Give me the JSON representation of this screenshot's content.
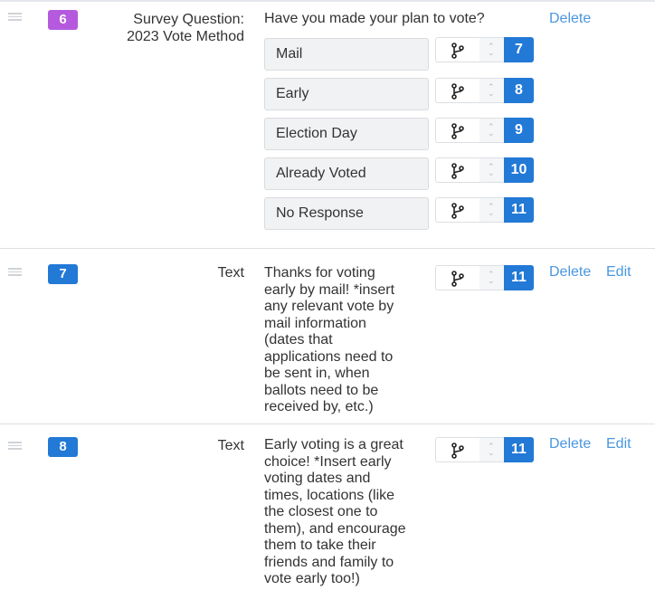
{
  "steps": [
    {
      "number": "6",
      "badge_color": "#b55ade",
      "type_label_line1": "Survey Question:",
      "type_label_line2": "2023 Vote Method",
      "question": "Have you made your plan to vote?",
      "answers": [
        {
          "label": "Mail",
          "next_step": "7"
        },
        {
          "label": "Early",
          "next_step": "8"
        },
        {
          "label": "Election Day",
          "next_step": "9"
        },
        {
          "label": "Already Voted",
          "next_step": "10"
        },
        {
          "label": "No Response",
          "next_step": "11"
        }
      ],
      "actions": {
        "delete": "Delete"
      }
    },
    {
      "number": "7",
      "badge_color": "#2279d6",
      "type_label": "Text",
      "body_lines": [
        "Thanks for voting",
        "early by mail! *insert",
        "any relevant vote by",
        "mail information",
        "(dates that",
        "applications need to",
        "be sent in, when",
        "ballots need to be",
        "received by, etc.)"
      ],
      "next_step": "11",
      "actions": {
        "delete": "Delete",
        "edit": "Edit"
      }
    },
    {
      "number": "8",
      "badge_color": "#2279d6",
      "type_label": "Text",
      "body_lines": [
        "Early voting is a great",
        "choice! *Insert early",
        "voting dates and",
        "times, locations (like",
        "the closest one to",
        "them), and encourage",
        "them to take their",
        "friends and family to",
        "vote early too!)"
      ],
      "next_step": "11",
      "actions": {
        "delete": "Delete",
        "edit": "Edit"
      }
    }
  ],
  "colors": {
    "link": "#4a97e0",
    "step_badge_blue": "#2279d6",
    "survey_badge_purple": "#b55ade"
  }
}
